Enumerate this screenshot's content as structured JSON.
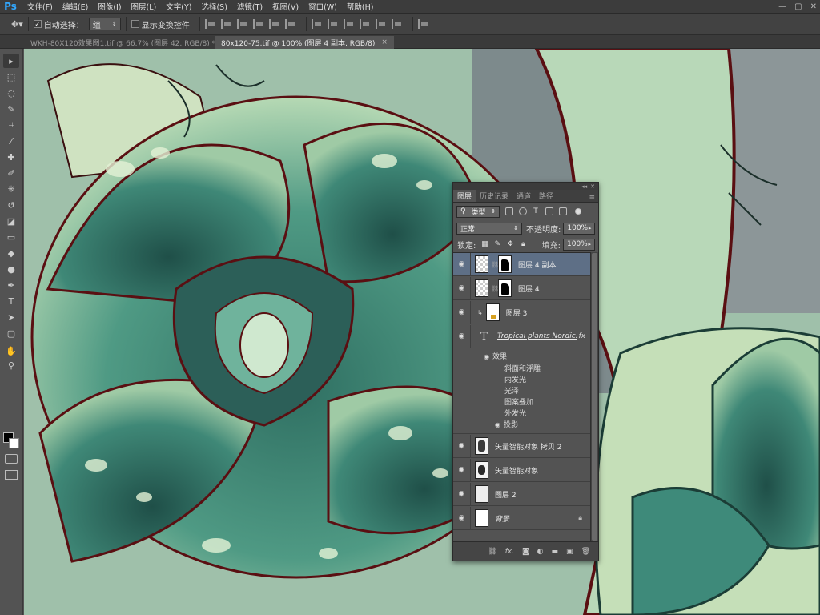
{
  "app": {
    "logo": "Ps"
  },
  "menu": [
    "文件(F)",
    "编辑(E)",
    "图像(I)",
    "图层(L)",
    "文字(Y)",
    "选择(S)",
    "滤镜(T)",
    "视图(V)",
    "窗口(W)",
    "帮助(H)"
  ],
  "window_controls": {
    "minimize": "—",
    "restore": "▢",
    "close": "✕"
  },
  "options": {
    "auto_select_label": "自动选择：",
    "auto_select_checked": true,
    "auto_select_value": "组",
    "show_transform_label": "显示变换控件",
    "show_transform_checked": false
  },
  "tabs": [
    {
      "title": "WKH-80X120效果图1.tif @ 66.7% (图层 42, RGB/8) *",
      "close": "×",
      "active": false
    },
    {
      "title": "80x120-75.tif @ 100% (图层 4 副本, RGB/8)",
      "close": "×",
      "active": true
    }
  ],
  "tools": [
    "move-tool",
    "marquee-tool",
    "lasso-tool",
    "quick-select-tool",
    "crop-tool",
    "eyedropper-tool",
    "healing-tool",
    "brush-tool",
    "clone-stamp-tool",
    "history-brush-tool",
    "eraser-tool",
    "gradient-tool",
    "blur-tool",
    "dodge-tool",
    "pen-tool",
    "type-tool",
    "path-select-tool",
    "shape-tool",
    "hand-tool",
    "zoom-tool"
  ],
  "tool_glyphs": [
    "▸",
    "⬚",
    "◌",
    "✎",
    "⌗",
    "⁄",
    "✚",
    "✐",
    "⎈",
    "↺",
    "◪",
    "▭",
    "◆",
    "●",
    "✒",
    "T",
    "➤",
    "▢",
    "✋",
    "⚲"
  ],
  "colors": {
    "foreground": "#000000",
    "background": "#ffffff",
    "accent": "#31a8ff",
    "selected_layer": "#5e6f86"
  },
  "panel": {
    "tabs": [
      "图层",
      "历史记录",
      "通道",
      "路径"
    ],
    "active_tab": "图层",
    "filter_kind": "类型",
    "blend_mode": "正常",
    "opacity_label": "不透明度:",
    "opacity_value": "100%",
    "lock_label": "锁定:",
    "fill_label": "填充:",
    "fill_value": "100%",
    "layers": [
      {
        "name": "图层 4 副本",
        "type": "masked",
        "active": true
      },
      {
        "name": "图层 4",
        "type": "masked",
        "active": false
      },
      {
        "name": "图层 3",
        "type": "clipped",
        "active": false
      },
      {
        "name": "Tropical plants Nordic...",
        "type": "text",
        "active": false,
        "fx": "fx"
      },
      {
        "name": "矢量智能对象 拷贝 2",
        "type": "smart",
        "active": false
      },
      {
        "name": "矢量智能对象",
        "type": "smart",
        "active": false
      },
      {
        "name": "图层 2",
        "type": "normal",
        "active": false
      },
      {
        "name": "背景",
        "type": "background",
        "active": false,
        "locked": true
      }
    ],
    "effects_label": "效果",
    "effects": [
      "斜面和浮雕",
      "内发光",
      "光泽",
      "图案叠加",
      "外发光",
      "投影"
    ]
  }
}
